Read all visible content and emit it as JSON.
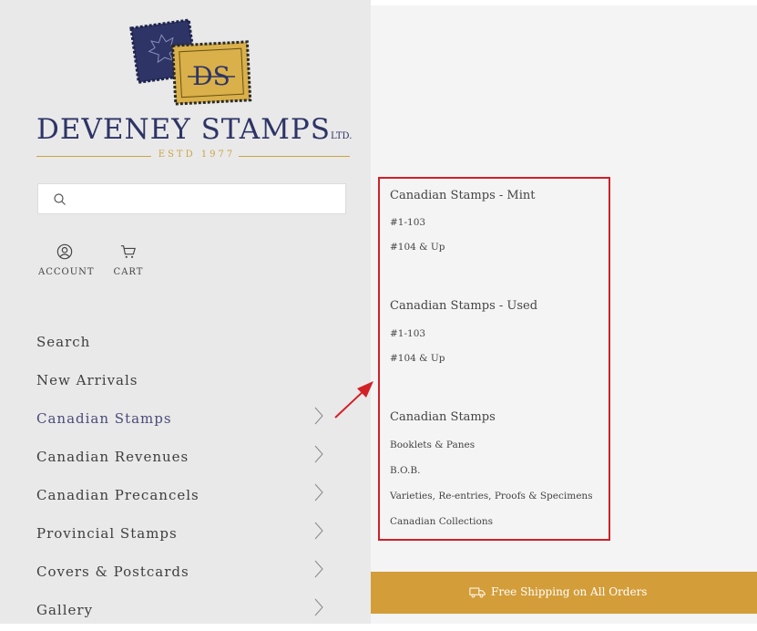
{
  "brand": {
    "name": "DEVENEY STAMPS",
    "suffix": "LTD.",
    "monogram": "DS",
    "established": "ESTD 1977"
  },
  "search": {
    "placeholder": "",
    "value": ""
  },
  "header_nav": {
    "account_label": "ACCOUNT",
    "cart_label": "CART"
  },
  "menu": {
    "items": [
      {
        "label": "Search",
        "has_submenu": false
      },
      {
        "label": "New Arrivals",
        "has_submenu": false
      },
      {
        "label": "Canadian Stamps",
        "has_submenu": true,
        "active": true
      },
      {
        "label": "Canadian Revenues",
        "has_submenu": true
      },
      {
        "label": "Canadian Precancels",
        "has_submenu": true
      },
      {
        "label": "Provincial Stamps",
        "has_submenu": true
      },
      {
        "label": "Covers & Postcards",
        "has_submenu": true
      },
      {
        "label": "Gallery",
        "has_submenu": true
      }
    ]
  },
  "submenu": {
    "groups": [
      {
        "heading": "Canadian Stamps - Mint",
        "links": [
          "#1-103",
          "#104 & Up"
        ]
      },
      {
        "heading": "Canadian Stamps - Used",
        "links": [
          "#1-103",
          "#104 & Up"
        ]
      },
      {
        "heading": "Canadian Stamps",
        "links": [
          "Booklets & Panes",
          "B.O.B.",
          "Varieties, Re-entries, Proofs & Specimens",
          "Canadian Collections"
        ]
      }
    ]
  },
  "banner": {
    "text": "Free Shipping on All Orders"
  },
  "colors": {
    "sidebar_bg": "#e9e9e9",
    "brand_navy": "#2e3466",
    "brand_gold": "#c9a441",
    "banner_bg": "#d39d39",
    "highlight_red": "#cf2028",
    "active_link": "#484b7a"
  }
}
